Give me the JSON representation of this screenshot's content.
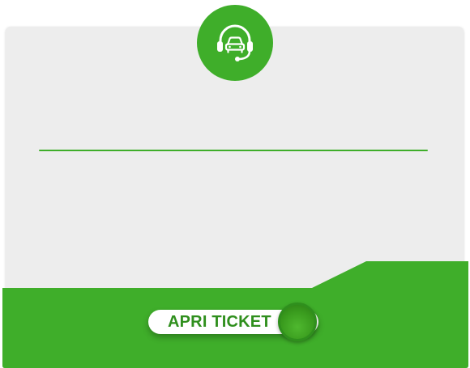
{
  "support_icon": {
    "icon": "car-support-headset-icon"
  },
  "ticket_button": {
    "label": "APRI TICKET"
  },
  "colors": {
    "accent": "#3fae2a",
    "accent_dark": "#2f8f1d",
    "panel": "#ededed"
  }
}
